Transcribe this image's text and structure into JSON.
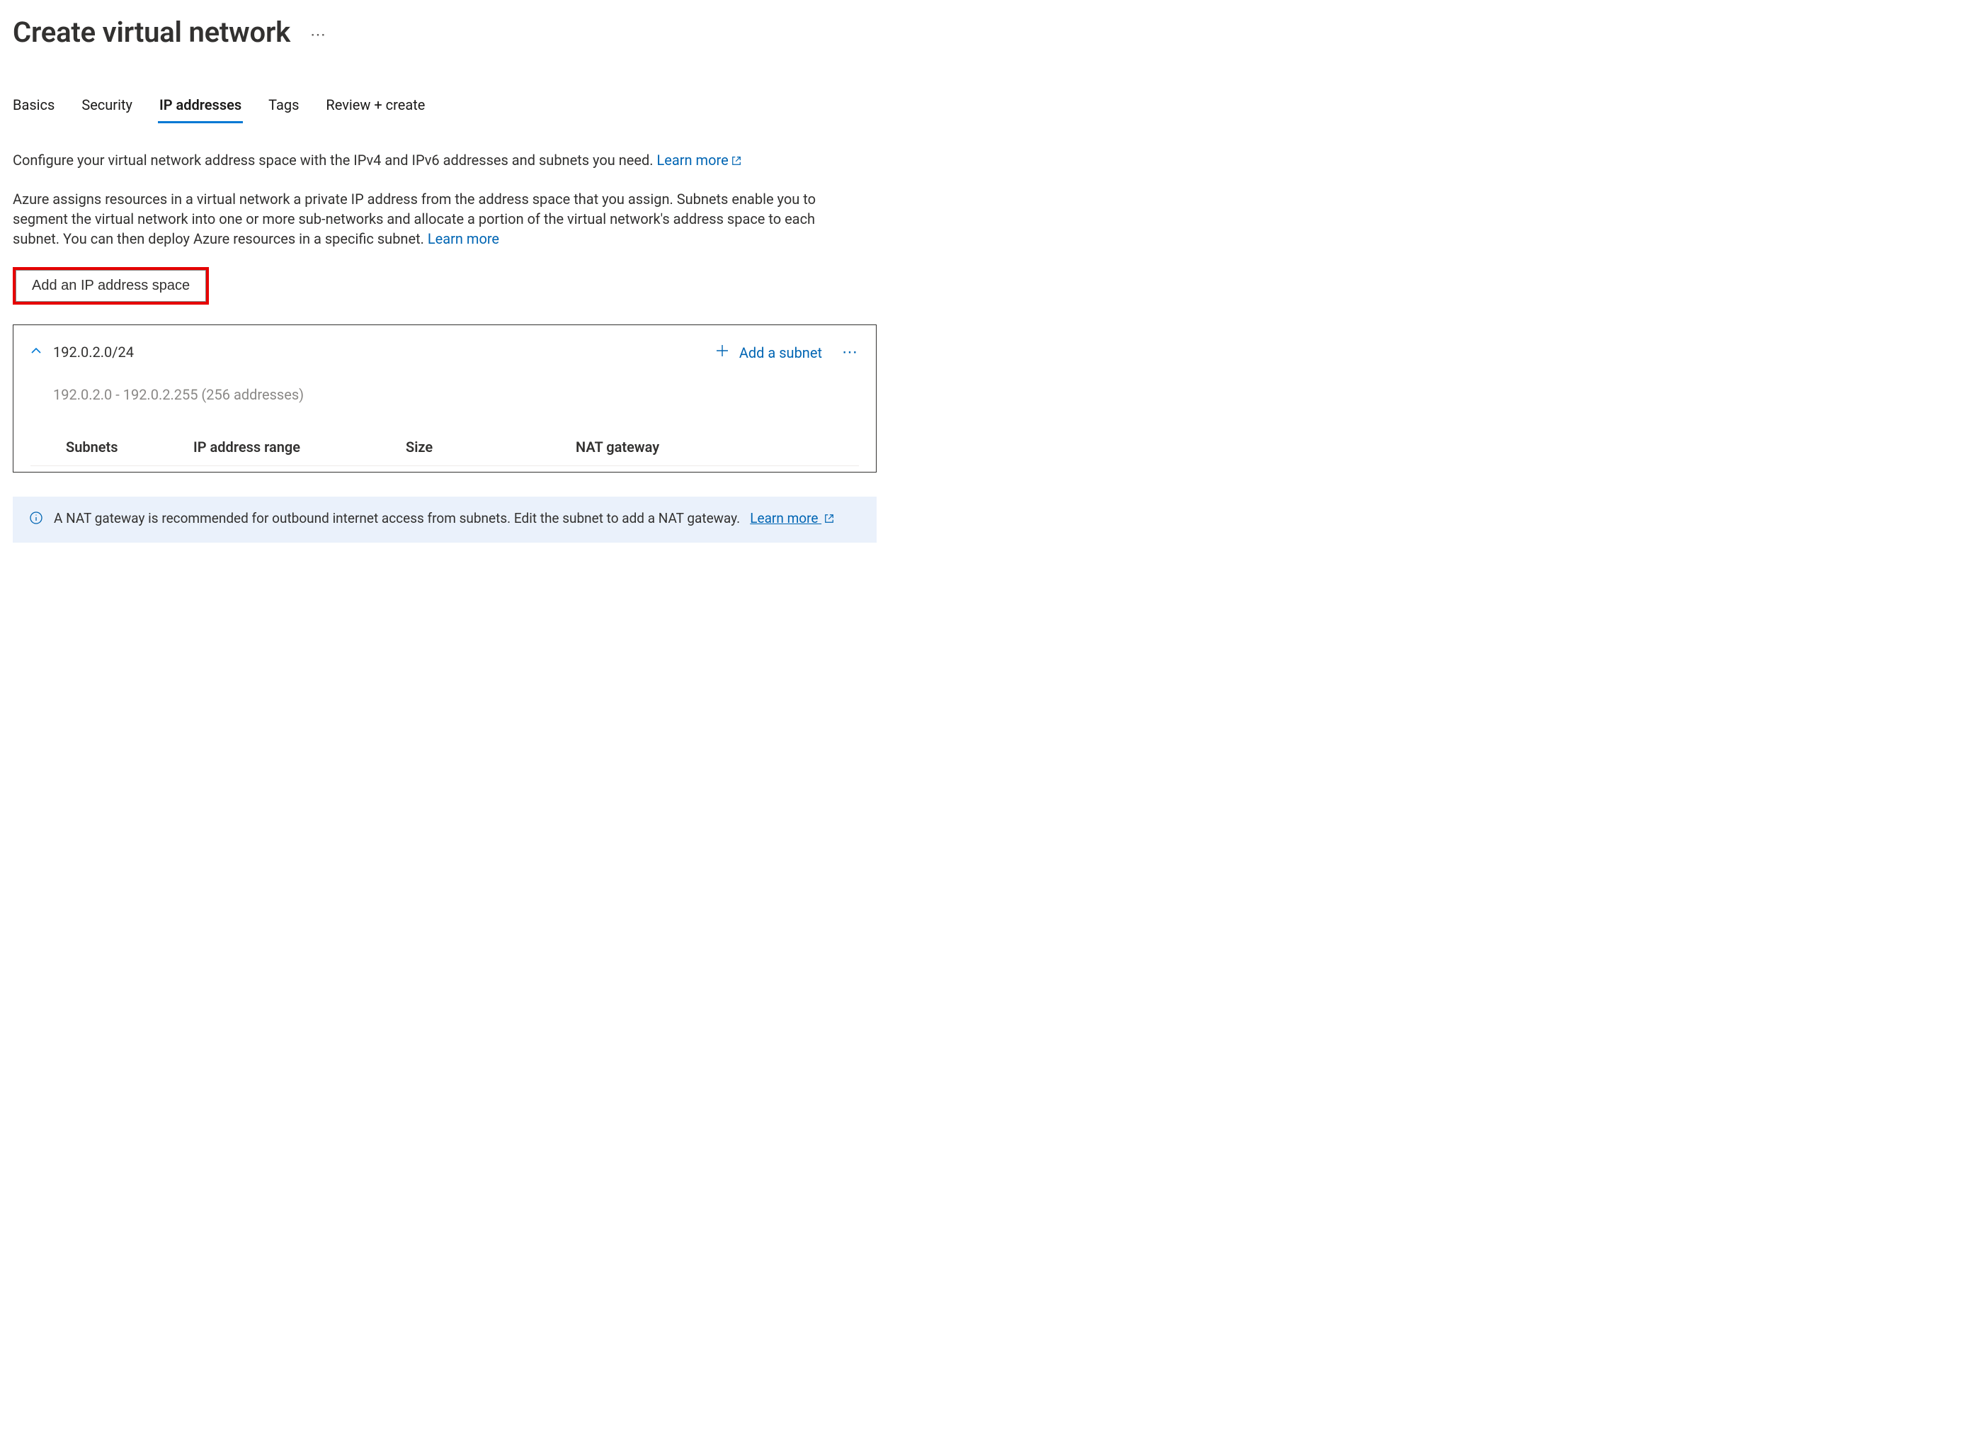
{
  "header": {
    "title": "Create virtual network"
  },
  "tabs": [
    {
      "label": "Basics"
    },
    {
      "label": "Security"
    },
    {
      "label": "IP addresses",
      "active": true
    },
    {
      "label": "Tags"
    },
    {
      "label": "Review + create"
    }
  ],
  "intro": {
    "line1_text": "Configure your virtual network address space with the IPv4 and IPv6 addresses and subnets you need.",
    "line1_link": "Learn more",
    "line2_text": "Azure assigns resources in a virtual network a private IP address from the address space that you assign. Subnets enable you to segment the virtual network into one or more sub-networks and allocate a portion of the virtual network's address space to each subnet. You can then deploy Azure resources in a specific subnet.",
    "line2_link": "Learn more"
  },
  "buttons": {
    "add_ip_space": "Add an IP address space",
    "add_subnet": "Add a subnet"
  },
  "address_space": {
    "cidr": "192.0.2.0/24",
    "range": "192.0.2.0 - 192.0.2.255 (256 addresses)"
  },
  "subnet_columns": {
    "subnets": "Subnets",
    "ip_range": "IP address range",
    "size": "Size",
    "nat_gateway": "NAT gateway"
  },
  "info_banner": {
    "text": "A NAT gateway is recommended for outbound internet access from subnets. Edit the subnet to add a NAT gateway.",
    "link": "Learn more"
  }
}
